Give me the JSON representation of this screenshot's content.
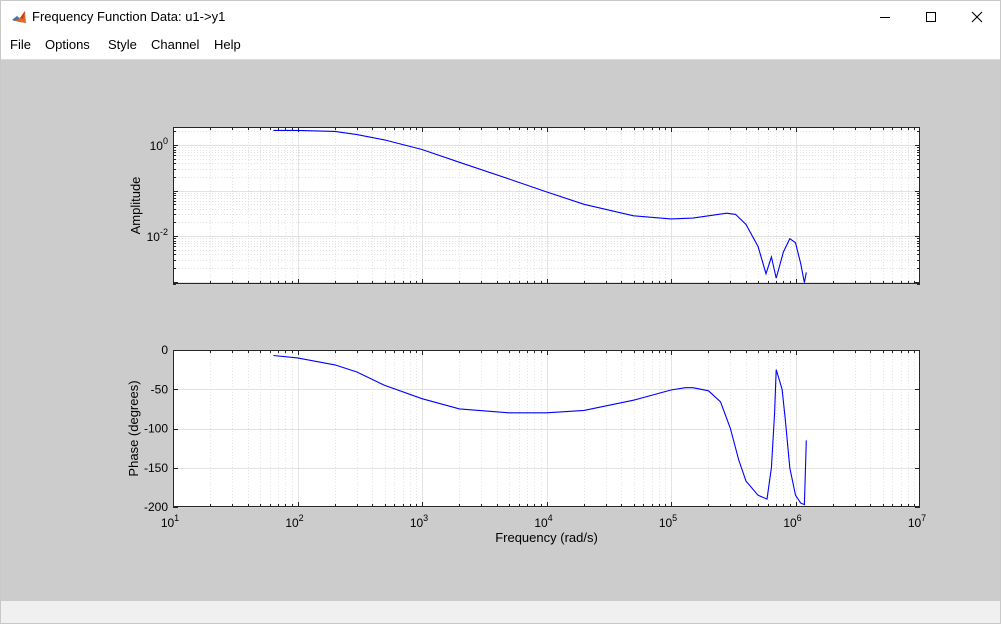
{
  "window": {
    "title": "Frequency Function Data: u1->y1"
  },
  "menu": {
    "items": [
      "File",
      "Options",
      "Style",
      "Channel",
      "Help"
    ]
  },
  "colors": {
    "line": "#0000ff",
    "figure_bg": "#cccccc",
    "axes_bg": "#ffffff",
    "grid": "#d9d9d9"
  },
  "chart_data": [
    {
      "type": "line",
      "title": "",
      "ylabel": "Amplitude",
      "xscale": "log",
      "yscale": "log",
      "grid": true,
      "xlim": [
        10,
        10000000
      ],
      "ylim": [
        0.00089,
        2.5
      ],
      "y_ticks": [
        {
          "mantissa": "10",
          "exp": "0",
          "value": 1
        },
        {
          "mantissa": "10",
          "exp": "-2",
          "value": 0.01
        }
      ],
      "series": [
        {
          "x": [
            64,
            100,
            200,
            300,
            500,
            1000,
            2000,
            5000,
            10000,
            20000,
            50000,
            100000,
            150000,
            200000,
            280000,
            330000,
            400000,
            500000,
            580000,
            640000,
            700000,
            800000,
            900000,
            1000000,
            1100000,
            1180000,
            1220000
          ],
          "y": [
            2.1,
            2.1,
            2.0,
            1.7,
            1.3,
            0.8,
            0.42,
            0.18,
            0.094,
            0.05,
            0.028,
            0.024,
            0.025,
            0.028,
            0.032,
            0.03,
            0.018,
            0.006,
            0.0015,
            0.0035,
            0.0012,
            0.0045,
            0.0088,
            0.0072,
            0.0025,
            0.00095,
            0.0016
          ]
        }
      ]
    },
    {
      "type": "line",
      "title": "",
      "xlabel": "Frequency (rad/s)",
      "ylabel": "Phase (degrees)",
      "xscale": "log",
      "grid": true,
      "xlim": [
        10,
        10000000
      ],
      "ylim": [
        -200,
        0
      ],
      "y_ticks": [
        "0",
        "-50",
        "-100",
        "-150",
        "-200"
      ],
      "x_ticks": [
        {
          "mantissa": "10",
          "exp": "1",
          "value": 10
        },
        {
          "mantissa": "10",
          "exp": "2",
          "value": 100
        },
        {
          "mantissa": "10",
          "exp": "3",
          "value": 1000
        },
        {
          "mantissa": "10",
          "exp": "4",
          "value": 10000
        },
        {
          "mantissa": "10",
          "exp": "5",
          "value": 100000
        },
        {
          "mantissa": "10",
          "exp": "6",
          "value": 1000000
        },
        {
          "mantissa": "10",
          "exp": "7",
          "value": 10000000
        }
      ],
      "series": [
        {
          "x": [
            64,
            100,
            200,
            300,
            500,
            1000,
            2000,
            5000,
            10000,
            20000,
            50000,
            100000,
            130000,
            150000,
            200000,
            250000,
            300000,
            350000,
            400000,
            500000,
            590000,
            640000,
            680000,
            700000,
            780000,
            830000,
            900000,
            1000000,
            1100000,
            1180000,
            1220000
          ],
          "y": [
            -7,
            -10,
            -19,
            -28,
            -45,
            -62,
            -75,
            -80,
            -80,
            -77,
            -64,
            -51,
            -48,
            -48,
            -52,
            -66,
            -100,
            -140,
            -167,
            -185,
            -190,
            -150,
            -80,
            -25,
            -50,
            -90,
            -150,
            -185,
            -195,
            -197,
            -115
          ]
        }
      ]
    }
  ]
}
